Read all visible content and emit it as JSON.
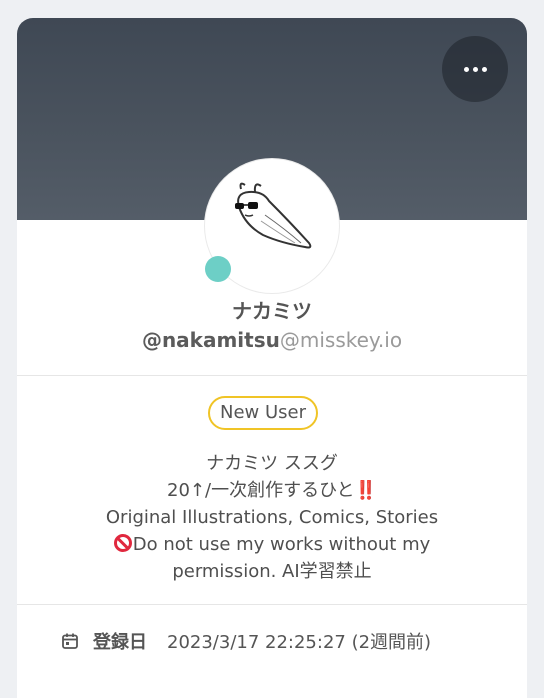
{
  "profile": {
    "display_name": "ナカミツ",
    "username": "@nakamitsu",
    "host": "@misskey.io",
    "badge": "New User",
    "bio": {
      "line1": "ナカミツ ススグ",
      "line2_text": "20↑/一次創作するひと",
      "line2_emoji": "‼️",
      "line3": "Original Illustrations, Comics, Stories",
      "line4": "Do not use my works without my",
      "line5": "permission. AI学習禁止"
    },
    "joined_label": "登録日",
    "joined_value": "2023/3/17 22:25:27 (2週間前)"
  },
  "icons": {
    "menu": "more-horizontal-icon",
    "calendar": "calendar-icon",
    "online": "online-status-indicator",
    "no-entry": "no-entry-icon"
  },
  "colors": {
    "banner": "#4a535e",
    "badge_border": "#f0c426",
    "online": "#6dcfc6",
    "warning": "#e0283e"
  }
}
